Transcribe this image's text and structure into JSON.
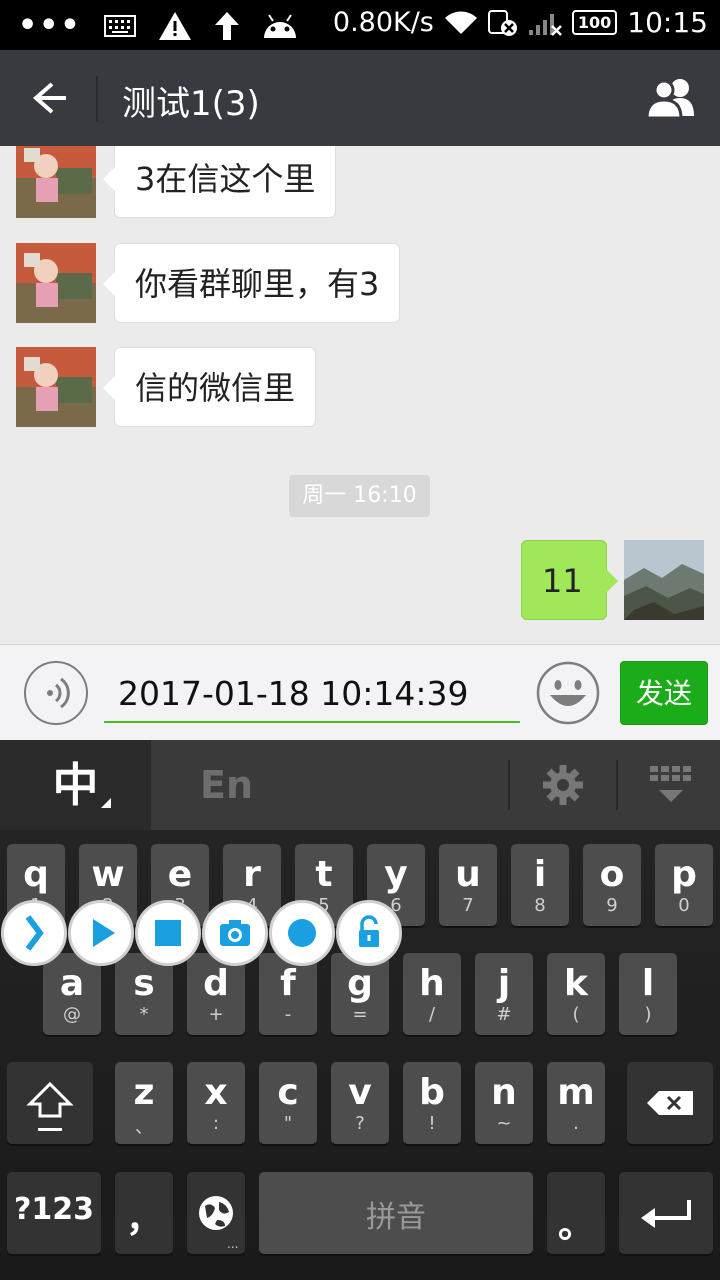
{
  "status_bar": {
    "speed": "0.80K/s",
    "battery": "100",
    "time": "10:15"
  },
  "titlebar": {
    "title": "测试1(3)"
  },
  "messages": [
    {
      "side": "left",
      "text": "3在信这个里"
    },
    {
      "side": "left",
      "text": "你看群聊里，有3"
    },
    {
      "side": "left",
      "text": "信的微信里"
    },
    {
      "side": "right",
      "text": "11"
    }
  ],
  "timestamp": "周一 16:10",
  "input": {
    "value": "2017-01-18 10:14:39",
    "send_label": "发送"
  },
  "keyboard": {
    "lang_zh": "中",
    "lang_en": "En",
    "row1": [
      {
        "main": "q",
        "sub": "1"
      },
      {
        "main": "w",
        "sub": "2"
      },
      {
        "main": "e",
        "sub": "3"
      },
      {
        "main": "r",
        "sub": "4"
      },
      {
        "main": "t",
        "sub": "5"
      },
      {
        "main": "y",
        "sub": "6"
      },
      {
        "main": "u",
        "sub": "7"
      },
      {
        "main": "i",
        "sub": "8"
      },
      {
        "main": "o",
        "sub": "9"
      },
      {
        "main": "p",
        "sub": "0"
      }
    ],
    "row2": [
      {
        "main": "a",
        "sub": "@"
      },
      {
        "main": "s",
        "sub": "*"
      },
      {
        "main": "d",
        "sub": "+"
      },
      {
        "main": "f",
        "sub": "-"
      },
      {
        "main": "g",
        "sub": "="
      },
      {
        "main": "h",
        "sub": "/"
      },
      {
        "main": "j",
        "sub": "#"
      },
      {
        "main": "k",
        "sub": "("
      },
      {
        "main": "l",
        "sub": ")"
      }
    ],
    "row3": [
      {
        "main": "z",
        "sub": "、"
      },
      {
        "main": "x",
        "sub": ":"
      },
      {
        "main": "c",
        "sub": "\""
      },
      {
        "main": "v",
        "sub": "?"
      },
      {
        "main": "b",
        "sub": "!"
      },
      {
        "main": "n",
        "sub": "~"
      },
      {
        "main": "m",
        "sub": "."
      }
    ],
    "sym_label": "?123",
    "comma": "，",
    "space_label": "拼音",
    "period": "。"
  }
}
